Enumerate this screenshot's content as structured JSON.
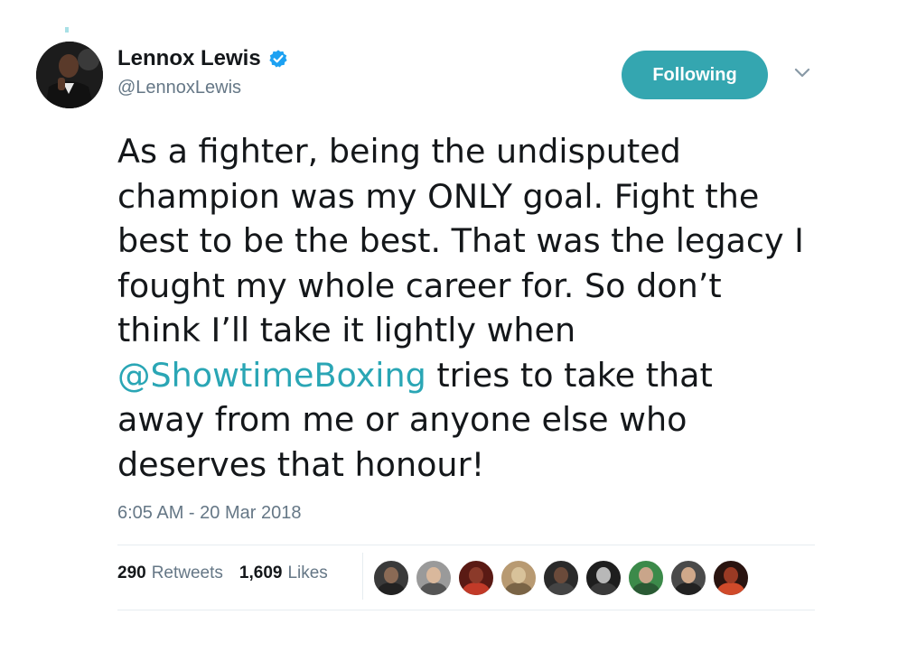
{
  "author": {
    "name": "Lennox Lewis",
    "handle": "@LennoxLewis",
    "verified": true
  },
  "follow_button": {
    "label": "Following",
    "color": "#34a6b0"
  },
  "menu": {
    "icon": "chevron-down-icon"
  },
  "tweet": {
    "text_before": "As a fighter, being the undisputed\nchampion was my ONLY goal. Fight the\nbest to be the best. That was the legacy I\nfought my whole career for. So don’t\nthink I’ll take it lightly when\n",
    "mention": "@ShowtimeBoxing",
    "text_after": " tries to take that\naway from me or anyone else who\ndeserves that honour!",
    "mention_color": "#2aa6b5"
  },
  "timestamp": "6:05 AM - 20 Mar 2018",
  "stats": {
    "retweets_count": "290",
    "retweets_label": "Retweets",
    "likes_count": "1,609",
    "likes_label": "Likes"
  },
  "likers": [
    {
      "bg": "#3a3a3a",
      "skin": "#8a6a55",
      "shirt": "#222222"
    },
    {
      "bg": "#9a9a9a",
      "skin": "#d9b89c",
      "shirt": "#555555"
    },
    {
      "bg": "#5a1a14",
      "skin": "#8b3a2a",
      "shirt": "#c23a28"
    },
    {
      "bg": "#b89a72",
      "skin": "#d8c29a",
      "shirt": "#7a6446"
    },
    {
      "bg": "#2a2a2a",
      "skin": "#6a4a3a",
      "shirt": "#444444"
    },
    {
      "bg": "#1e1e1e",
      "skin": "#b8b8b8",
      "shirt": "#3a3a3a"
    },
    {
      "bg": "#3c8a4a",
      "skin": "#c9a58a",
      "shirt": "#2a5a34"
    },
    {
      "bg": "#4a4a4a",
      "skin": "#cfa88a",
      "shirt": "#222222"
    },
    {
      "bg": "#2a1410",
      "skin": "#9a3a24",
      "shirt": "#d04a2a"
    }
  ]
}
